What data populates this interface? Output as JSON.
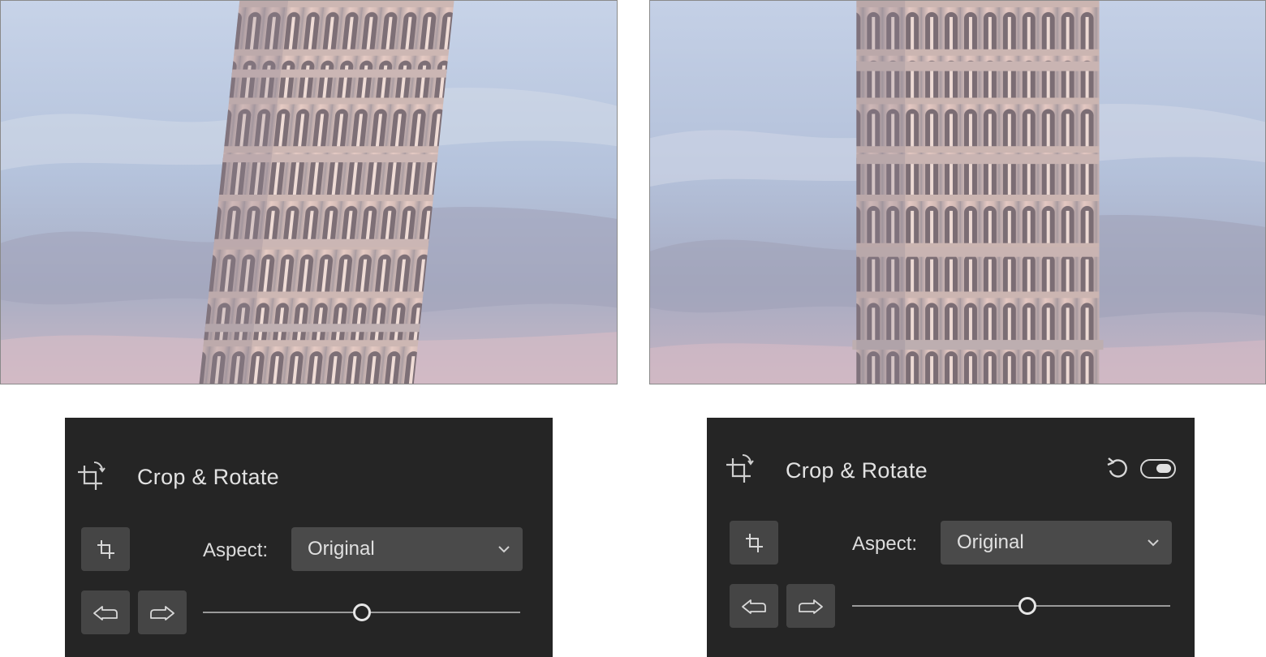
{
  "panels": {
    "left": {
      "title": "Crop & Rotate",
      "aspect_label": "Aspect:",
      "aspect_value": "Original",
      "straighten_fraction": 0.5,
      "show_reset": false,
      "show_toggle": false
    },
    "right": {
      "title": "Crop & Rotate",
      "aspect_label": "Aspect:",
      "aspect_value": "Original",
      "straighten_fraction": 0.55,
      "show_reset": true,
      "show_toggle": true,
      "toggle_on": true
    }
  },
  "icons": {
    "header": "crop-rotate-icon",
    "crop": "crop-icon",
    "rotate_left": "rotate-left-icon",
    "rotate_right": "rotate-right-icon",
    "dropdown": "chevron-down-icon",
    "reset": "reset-icon",
    "toggle": "toggle-switch"
  },
  "colors": {
    "panel_bg": "#252525",
    "button_bg": "#454545",
    "sky": "#b9c6dd",
    "tower": "#d9c3bc"
  }
}
